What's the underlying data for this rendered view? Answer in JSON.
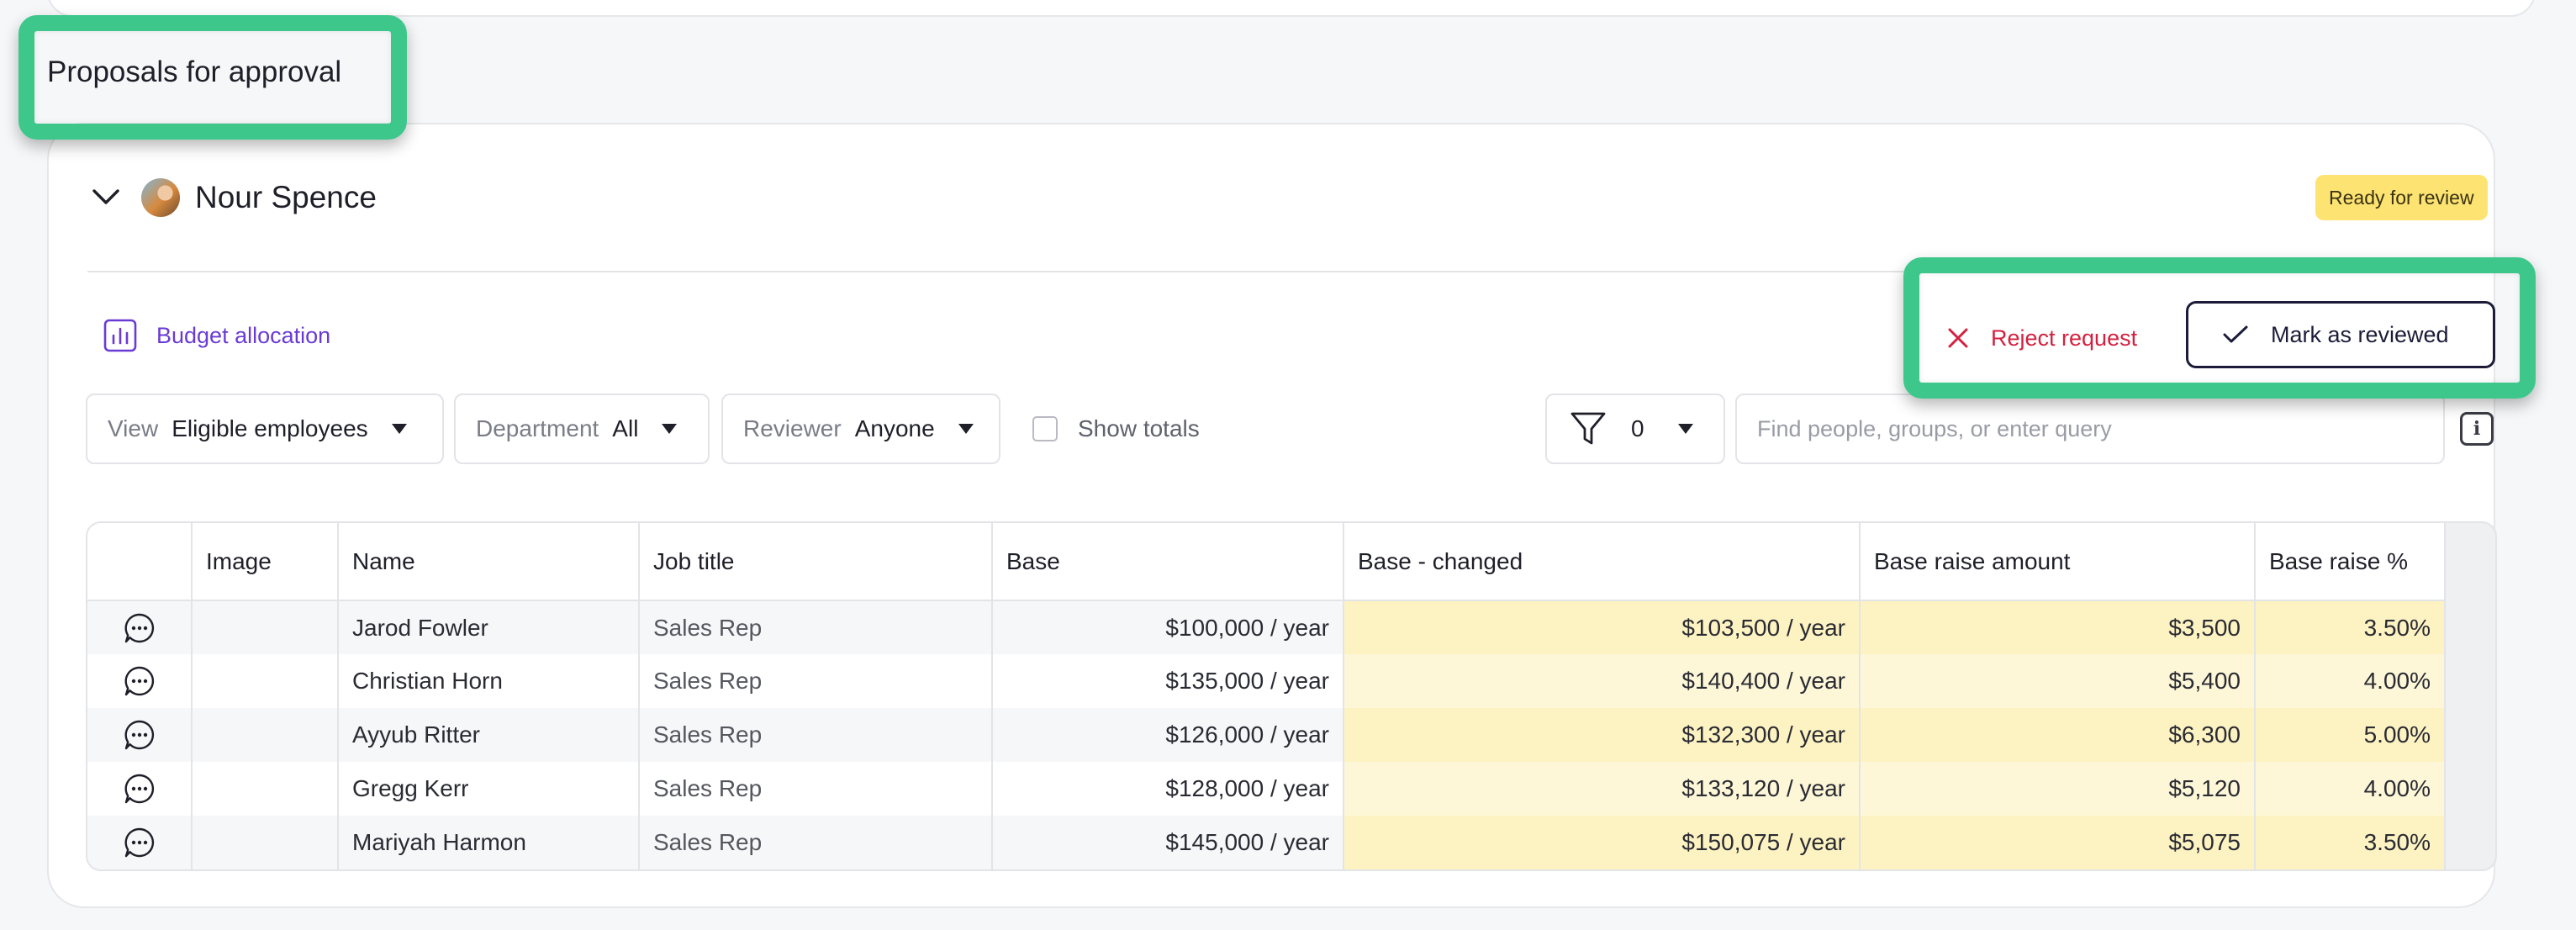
{
  "section": {
    "title": "Proposals for approval"
  },
  "card": {
    "person_name": "Nour Spence",
    "status_badge": "Ready for review",
    "budget_label": "Budget allocation",
    "reject_label": "Reject request",
    "mark_label": "Mark as reviewed"
  },
  "filters": {
    "view_label": "View",
    "view_value": "Eligible employees",
    "department_label": "Department",
    "department_value": "All",
    "reviewer_label": "Reviewer",
    "reviewer_value": "Anyone",
    "show_totals_label": "Show totals",
    "filter_count": "0",
    "search_placeholder": "Find people, groups, or enter query",
    "info_glyph": "i"
  },
  "table": {
    "headers": [
      "Image",
      "Name",
      "Job title",
      "Base",
      "Base - changed",
      "Base raise amount",
      "Base raise %"
    ],
    "rows": [
      {
        "name": "Jarod Fowler",
        "job": "Sales Rep",
        "base": "$100,000 / year",
        "base_changed": "$103,500 / year",
        "raise_amount": "$3,500",
        "raise_pct": "3.50%"
      },
      {
        "name": "Christian Horn",
        "job": "Sales Rep",
        "base": "$135,000 / year",
        "base_changed": "$140,400 / year",
        "raise_amount": "$5,400",
        "raise_pct": "4.00%"
      },
      {
        "name": "Ayyub Ritter",
        "job": "Sales Rep",
        "base": "$126,000 / year",
        "base_changed": "$132,300 / year",
        "raise_amount": "$6,300",
        "raise_pct": "5.00%"
      },
      {
        "name": "Gregg Kerr",
        "job": "Sales Rep",
        "base": "$128,000 / year",
        "base_changed": "$133,120 / year",
        "raise_amount": "$5,120",
        "raise_pct": "4.00%"
      },
      {
        "name": "Mariyah Harmon",
        "job": "Sales Rep",
        "base": "$145,000 / year",
        "base_changed": "$150,075 / year",
        "raise_amount": "$5,075",
        "raise_pct": "3.50%"
      }
    ]
  },
  "colors": {
    "highlight": "#3ec78b",
    "badge": "#fde372",
    "reject": "#d4213f",
    "budget": "#6a3bd4",
    "changed_cell": "#fdf3c2"
  },
  "icons": [
    "chevron-down-icon",
    "avatar",
    "bar-chart-icon",
    "close-icon",
    "check-icon",
    "caret-down-icon",
    "funnel-icon",
    "info-icon",
    "comment-icon"
  ]
}
